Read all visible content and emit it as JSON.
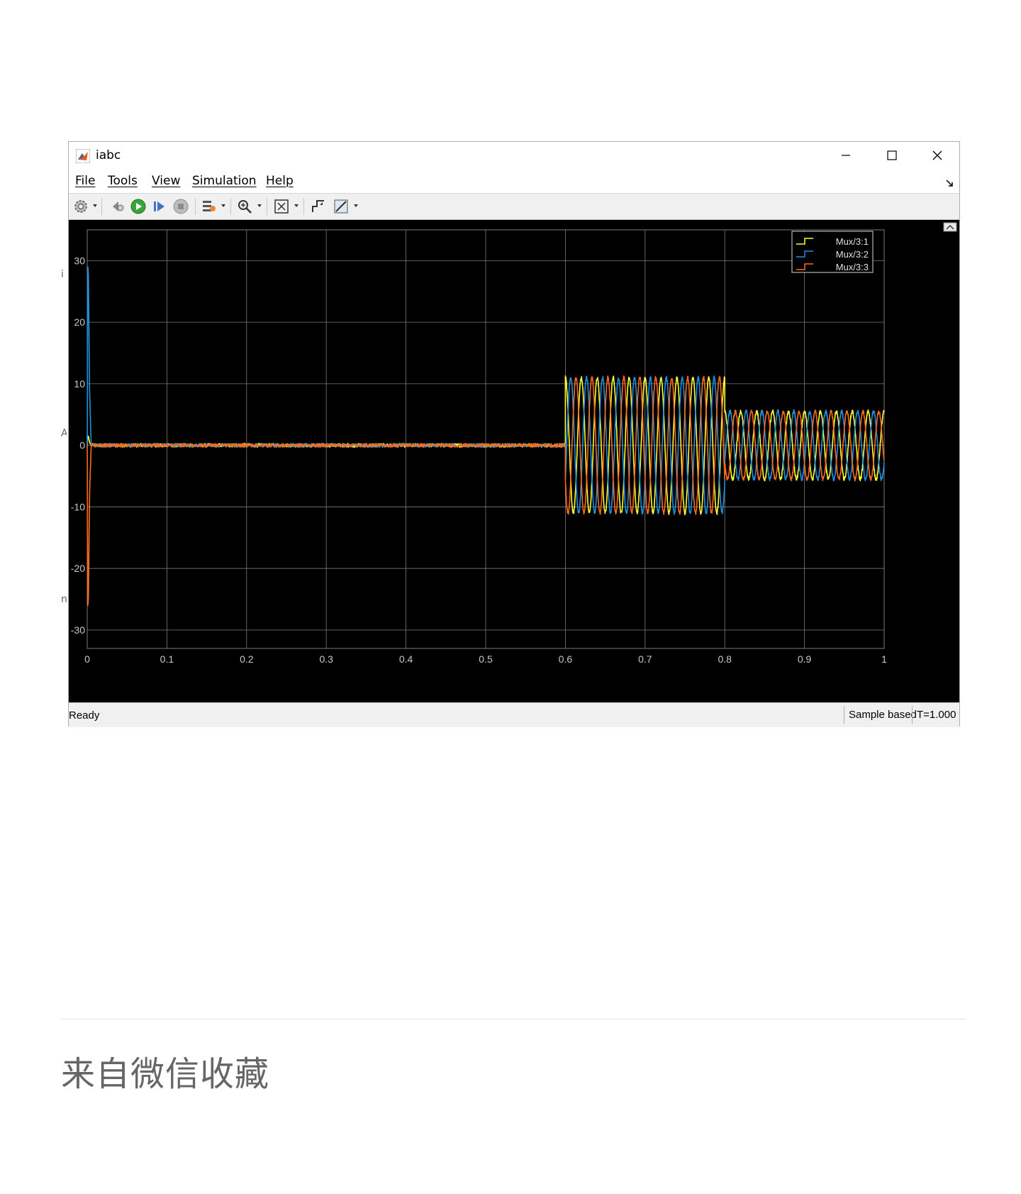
{
  "window": {
    "title": "iabc",
    "menu": [
      "File",
      "Tools",
      "View",
      "Simulation",
      "Help"
    ]
  },
  "toolbar": {
    "icons": [
      "settings-icon",
      "step-back-icon",
      "run-icon",
      "step-forward-icon",
      "stop-icon",
      "signal-tools-icon",
      "zoom-icon",
      "autoscale-icon",
      "triggers-icon",
      "measurements-icon"
    ]
  },
  "status": {
    "ready": "Ready",
    "mode": "Sample based",
    "time": "T=1.000"
  },
  "footer": {
    "text": "来自微信收藏"
  },
  "colors": {
    "series1": "#ffff33",
    "series2": "#1e90e0",
    "series3": "#ff6a1a",
    "grid": "#7a7a7a",
    "axis_text": "#c8c8c8",
    "plot_background": "#000000"
  },
  "chart_data": {
    "type": "line",
    "title": "",
    "xlabel": "",
    "ylabel": "",
    "xlim": [
      0,
      1
    ],
    "ylim": [
      -33,
      35
    ],
    "x_ticks": [
      "0",
      "0.1",
      "0.2",
      "0.3",
      "0.4",
      "0.5",
      "0.6",
      "0.7",
      "0.8",
      "0.9",
      "1"
    ],
    "y_ticks": [
      "30",
      "20",
      "10",
      "0",
      "-10",
      "-20",
      "-30"
    ],
    "grid": true,
    "legend_position": "top-right",
    "frequency_hz": 50,
    "series": [
      {
        "name": "Mux/3:1",
        "color": "#ffff33",
        "segments": [
          {
            "t_start": 0.0,
            "t_end": 0.005,
            "peak": 1.5,
            "shape": "startup"
          },
          {
            "t_start": 0.005,
            "t_end": 0.6,
            "amplitude": 0.3,
            "shape": "noise"
          },
          {
            "t_start": 0.6,
            "t_end": 0.8,
            "amplitude": 11,
            "phase_deg": 0,
            "shape": "sine"
          },
          {
            "t_start": 0.8,
            "t_end": 1.0,
            "amplitude": 5.5,
            "phase_deg": 0,
            "shape": "sine"
          }
        ]
      },
      {
        "name": "Mux/3:2",
        "color": "#1e90e0",
        "segments": [
          {
            "t_start": 0.0,
            "t_end": 0.005,
            "peak": 29,
            "shape": "startup"
          },
          {
            "t_start": 0.005,
            "t_end": 0.6,
            "amplitude": 0.3,
            "shape": "noise"
          },
          {
            "t_start": 0.6,
            "t_end": 0.8,
            "amplitude": 11,
            "phase_deg": -120,
            "shape": "sine"
          },
          {
            "t_start": 0.8,
            "t_end": 1.0,
            "amplitude": 5.5,
            "phase_deg": -120,
            "shape": "sine"
          }
        ]
      },
      {
        "name": "Mux/3:3",
        "color": "#ff6a1a",
        "segments": [
          {
            "t_start": 0.0,
            "t_end": 0.005,
            "peak": -26,
            "shape": "startup"
          },
          {
            "t_start": 0.005,
            "t_end": 0.6,
            "amplitude": 0.3,
            "shape": "noise"
          },
          {
            "t_start": 0.6,
            "t_end": 0.8,
            "amplitude": 11,
            "phase_deg": 120,
            "shape": "sine"
          },
          {
            "t_start": 0.8,
            "t_end": 1.0,
            "amplitude": 5.5,
            "phase_deg": 120,
            "shape": "sine"
          }
        ]
      }
    ]
  }
}
